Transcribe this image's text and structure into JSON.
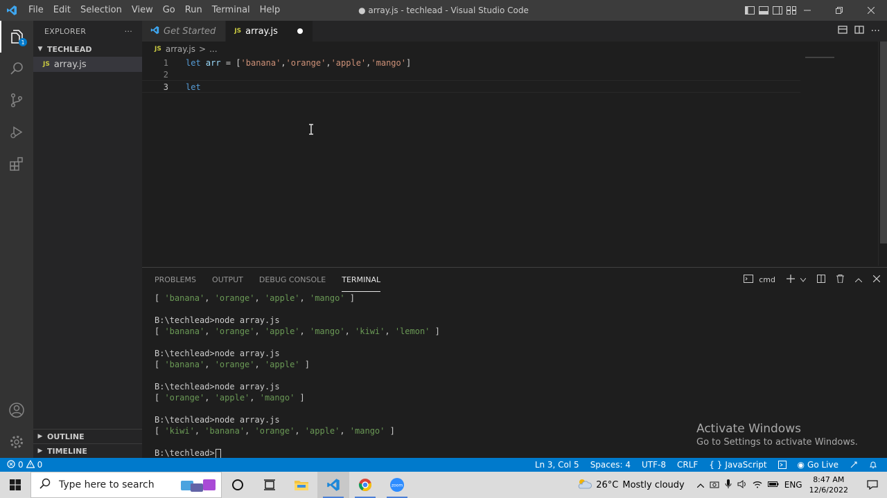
{
  "titlebar": {
    "menu": [
      "File",
      "Edit",
      "Selection",
      "View",
      "Go",
      "Run",
      "Terminal",
      "Help"
    ],
    "window_title": "● array.js - techlead - Visual Studio Code"
  },
  "sidebar": {
    "header": "EXPLORER",
    "folder": "TECHLEAD",
    "file": "array.js",
    "outline": "OUTLINE",
    "timeline": "TIMELINE"
  },
  "tabs": [
    {
      "label": "Get Started"
    },
    {
      "label": "array.js",
      "badge": "JS"
    }
  ],
  "breadcrumb": {
    "file": "array.js",
    "sep": ">",
    "more": "..."
  },
  "editor": {
    "lines": [
      {
        "num": "1",
        "kw": "let",
        "var": "arr",
        "rest": " = [",
        "s1": "'banana'",
        "s2": "'orange'",
        "s3": "'apple'",
        "s4": "'mango'"
      },
      {
        "num": "2"
      },
      {
        "num": "3",
        "kw": "let"
      }
    ]
  },
  "panel": {
    "tabs": [
      "PROBLEMS",
      "OUTPUT",
      "DEBUG CONSOLE",
      "TERMINAL"
    ],
    "shell": "cmd",
    "terminal": [
      {
        "prompt": "",
        "arr": [
          "'banana'",
          "'orange'",
          "'apple'",
          "'mango'"
        ]
      },
      {
        "prompt": "B:\\techlead>node array.js",
        "arr": [
          "'banana'",
          "'orange'",
          "'apple'",
          "'mango'",
          "'kiwi'",
          "'lemon'"
        ]
      },
      {
        "prompt": "B:\\techlead>node array.js",
        "arr": [
          "'banana'",
          "'orange'",
          "'apple'"
        ]
      },
      {
        "prompt": "B:\\techlead>node array.js",
        "arr": [
          "'orange'",
          "'apple'",
          "'mango'"
        ]
      },
      {
        "prompt": "B:\\techlead>node array.js",
        "arr": [
          "'kiwi'",
          "'banana'",
          "'orange'",
          "'apple'",
          "'mango'"
        ]
      }
    ],
    "current_prompt": "B:\\techlead>"
  },
  "activation": {
    "title": "Activate Windows",
    "subtitle": "Go to Settings to activate Windows."
  },
  "statusbar": {
    "errors": "0",
    "warnings": "0",
    "position": "Ln 3, Col 5",
    "spaces": "Spaces: 4",
    "encoding": "UTF-8",
    "eol": "CRLF",
    "language": "JavaScript",
    "golive": "Go Live"
  },
  "taskbar": {
    "search_placeholder": "Type here to search",
    "temperature": "26°C",
    "weather": "Mostly cloudy",
    "lang": "ENG",
    "time": "8:47 AM",
    "date": "12/6/2022"
  },
  "colors": {
    "accent": "#007acc",
    "keyword": "#569cd6",
    "string": "#ce9178",
    "variable": "#9cdcfe"
  },
  "icons": [
    "vscode-logo",
    "explorer-icon",
    "search-icon",
    "source-control-icon",
    "run-debug-icon",
    "extensions-icon",
    "account-icon",
    "manage-gear-icon"
  ]
}
